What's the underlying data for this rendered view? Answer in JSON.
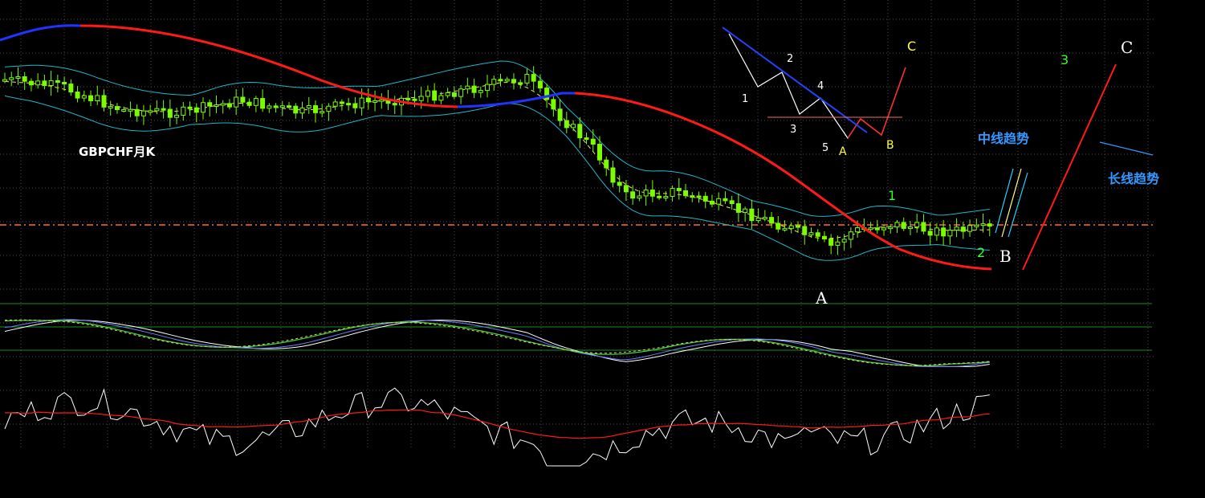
{
  "chart_title": "GBPCHF月K",
  "wave_labels": {
    "main_A": "A",
    "main_B": "B",
    "main_C": "C",
    "sub_1": "1",
    "sub_2": "2",
    "sub_3": "3"
  },
  "inset_labels": {
    "w1": "1",
    "w2": "2",
    "w3": "3",
    "w4": "4",
    "w5": "5",
    "A": "A",
    "B": "B",
    "C": "C"
  },
  "trend_labels": {
    "medium": "中线趋势",
    "long": "长线趋势"
  },
  "colors": {
    "background": "#000000",
    "grid": "#4a4a4a",
    "candle": "#7CFC00",
    "bollinger": "#1fb7c9",
    "bollinger_mid": "#e8e85a",
    "ma_red": "#ff1a1a",
    "ma_blue": "#2233ff",
    "support_line": "#ff6a2a",
    "oscillator_white": "#ffffff",
    "oscillator_blue": "#6f7fff",
    "oscillator_green": "#4fd44f",
    "oscillator_yellow": "#d8d84a",
    "trend_blue": "#3399ff",
    "label_yellow": "#ffff33",
    "label_green": "#33ff33",
    "label_white": "#ffffff"
  },
  "chart_data": {
    "type": "candlestick",
    "symbol": "GBPCHF",
    "period": "月K",
    "panes": [
      "price",
      "oscillator",
      "momentum"
    ],
    "grid": true,
    "candle_count": 150,
    "price_trend_points": [
      {
        "x": 0,
        "y": 0.22
      },
      {
        "x": 0.06,
        "y": 0.25
      },
      {
        "x": 0.12,
        "y": 0.34
      },
      {
        "x": 0.18,
        "y": 0.35
      },
      {
        "x": 0.24,
        "y": 0.3
      },
      {
        "x": 0.3,
        "y": 0.35
      },
      {
        "x": 0.36,
        "y": 0.31
      },
      {
        "x": 0.42,
        "y": 0.29
      },
      {
        "x": 0.48,
        "y": 0.25
      },
      {
        "x": 0.53,
        "y": 0.21
      },
      {
        "x": 0.56,
        "y": 0.35
      },
      {
        "x": 0.6,
        "y": 0.5
      },
      {
        "x": 0.63,
        "y": 0.68
      },
      {
        "x": 0.68,
        "y": 0.66
      },
      {
        "x": 0.74,
        "y": 0.73
      },
      {
        "x": 0.8,
        "y": 0.81
      },
      {
        "x": 0.84,
        "y": 0.88
      },
      {
        "x": 0.86,
        "y": 0.82
      },
      {
        "x": 0.9,
        "y": 0.79
      },
      {
        "x": 0.95,
        "y": 0.82
      },
      {
        "x": 1.0,
        "y": 0.81
      }
    ]
  }
}
